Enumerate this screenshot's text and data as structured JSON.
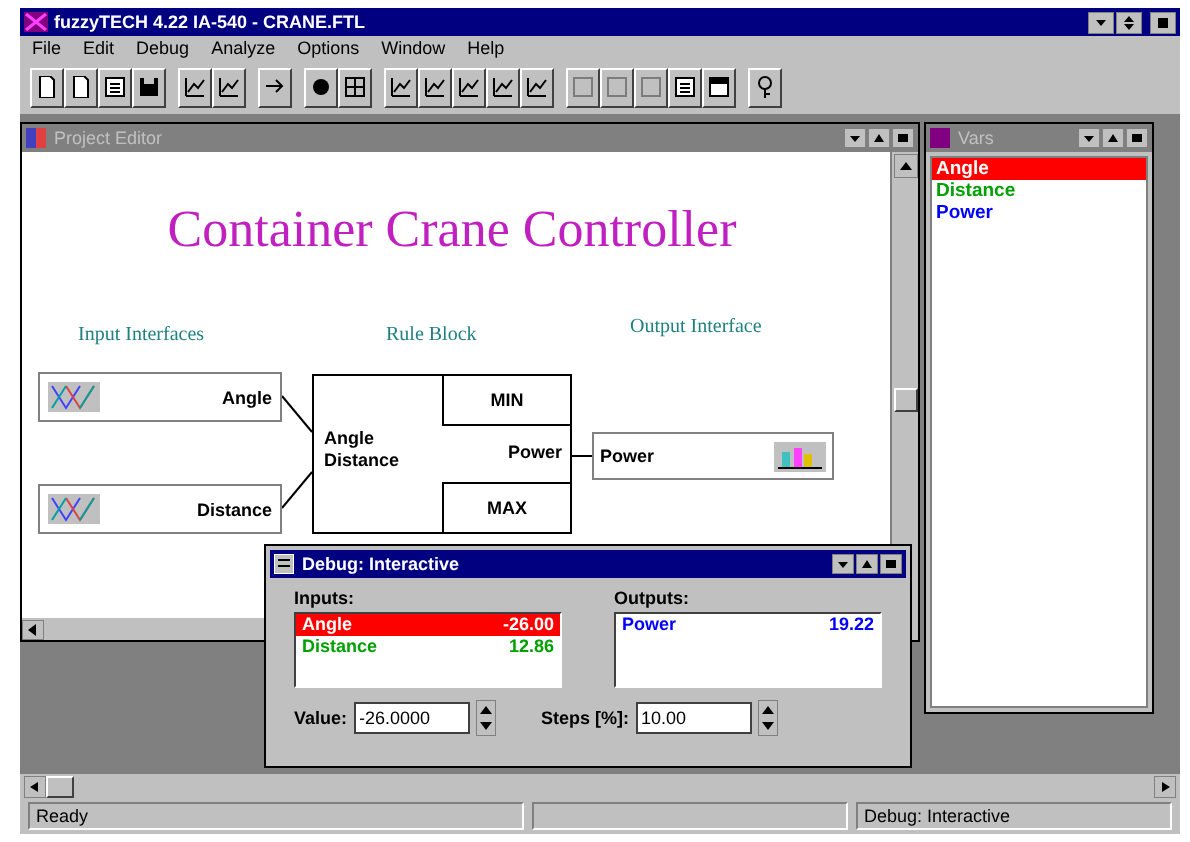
{
  "app": {
    "title": "fuzzyTECH 4.22 IA-540 - CRANE.FTL"
  },
  "menu": [
    "File",
    "Edit",
    "Debug",
    "Analyze",
    "Options",
    "Window",
    "Help"
  ],
  "toolbar": [
    {
      "disabled": false
    },
    {
      "disabled": false
    },
    {
      "disabled": false
    },
    {
      "disabled": false
    },
    {
      "disabled": false
    },
    {
      "disabled": false
    },
    {
      "disabled": false
    },
    {
      "disabled": false
    },
    {
      "disabled": false
    },
    {
      "disabled": false
    },
    {
      "disabled": false
    },
    {
      "disabled": false
    },
    {
      "disabled": false
    },
    {
      "disabled": false
    },
    {
      "disabled": true
    },
    {
      "disabled": true
    },
    {
      "disabled": true
    },
    {
      "disabled": false
    },
    {
      "disabled": false
    },
    {
      "disabled": false
    }
  ],
  "project_editor": {
    "title": "Project Editor",
    "heading": "Container Crane Controller",
    "section_labels": [
      "Input Interfaces",
      "Rule Block",
      "Output Interface"
    ],
    "inputs": [
      "Angle",
      "Distance"
    ],
    "rule_block": {
      "inputs": [
        "Angle",
        "Distance"
      ],
      "top": "MIN",
      "output": "Power",
      "bottom": "MAX"
    },
    "output": "Power"
  },
  "vars_window": {
    "title": "Vars",
    "items": [
      {
        "name": "Angle",
        "color": "#ff0000",
        "selected": true
      },
      {
        "name": "Distance",
        "color": "#00a000",
        "selected": false
      },
      {
        "name": "Power",
        "color": "#0000ff",
        "selected": false
      }
    ]
  },
  "debug_window": {
    "title": "Debug: Interactive",
    "inputs_label": "Inputs:",
    "outputs_label": "Outputs:",
    "inputs": [
      {
        "name": "Angle",
        "value": "-26.00",
        "color": "#ff0000",
        "selected": true
      },
      {
        "name": "Distance",
        "value": "12.86",
        "color": "#00a000",
        "selected": false
      }
    ],
    "outputs": [
      {
        "name": "Power",
        "value": "19.22",
        "color": "#0000ff",
        "selected": false
      }
    ],
    "value_label": "Value:",
    "value": "-26.0000",
    "steps_label": "Steps [%]:",
    "steps": "10.00"
  },
  "status_bar": {
    "left": "Ready",
    "right": "Debug: Interactive"
  }
}
